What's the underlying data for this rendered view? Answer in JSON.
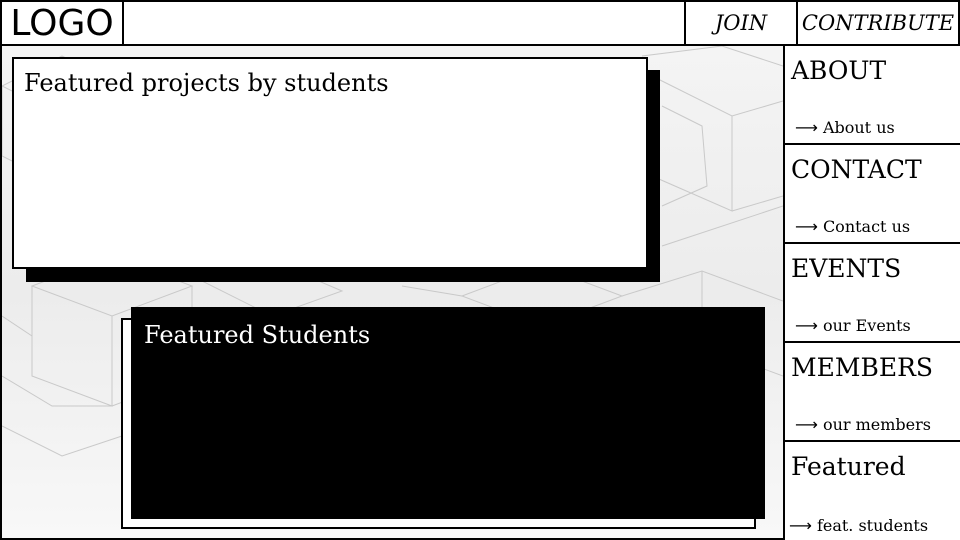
{
  "header": {
    "logo": "LOGO",
    "nav_join": "JOIN",
    "nav_contribute": "CONTRIBUTE"
  },
  "main": {
    "projects_title": "Featured projects by students",
    "students_title": "Featured Students"
  },
  "sidebar": {
    "items": [
      {
        "heading": "ABOUT",
        "link": "About us"
      },
      {
        "heading": "CONTACT",
        "link": "Contact us"
      },
      {
        "heading": "EVENTS",
        "link": "our Events"
      },
      {
        "heading": "MEMBERS",
        "link": "our members"
      },
      {
        "heading": "Featured",
        "link": "feat. students"
      }
    ],
    "arrow_icon": "long-right-arrow"
  },
  "colors": {
    "border": "#000000",
    "background": "#ffffff",
    "pattern": "#cfcfcf"
  }
}
